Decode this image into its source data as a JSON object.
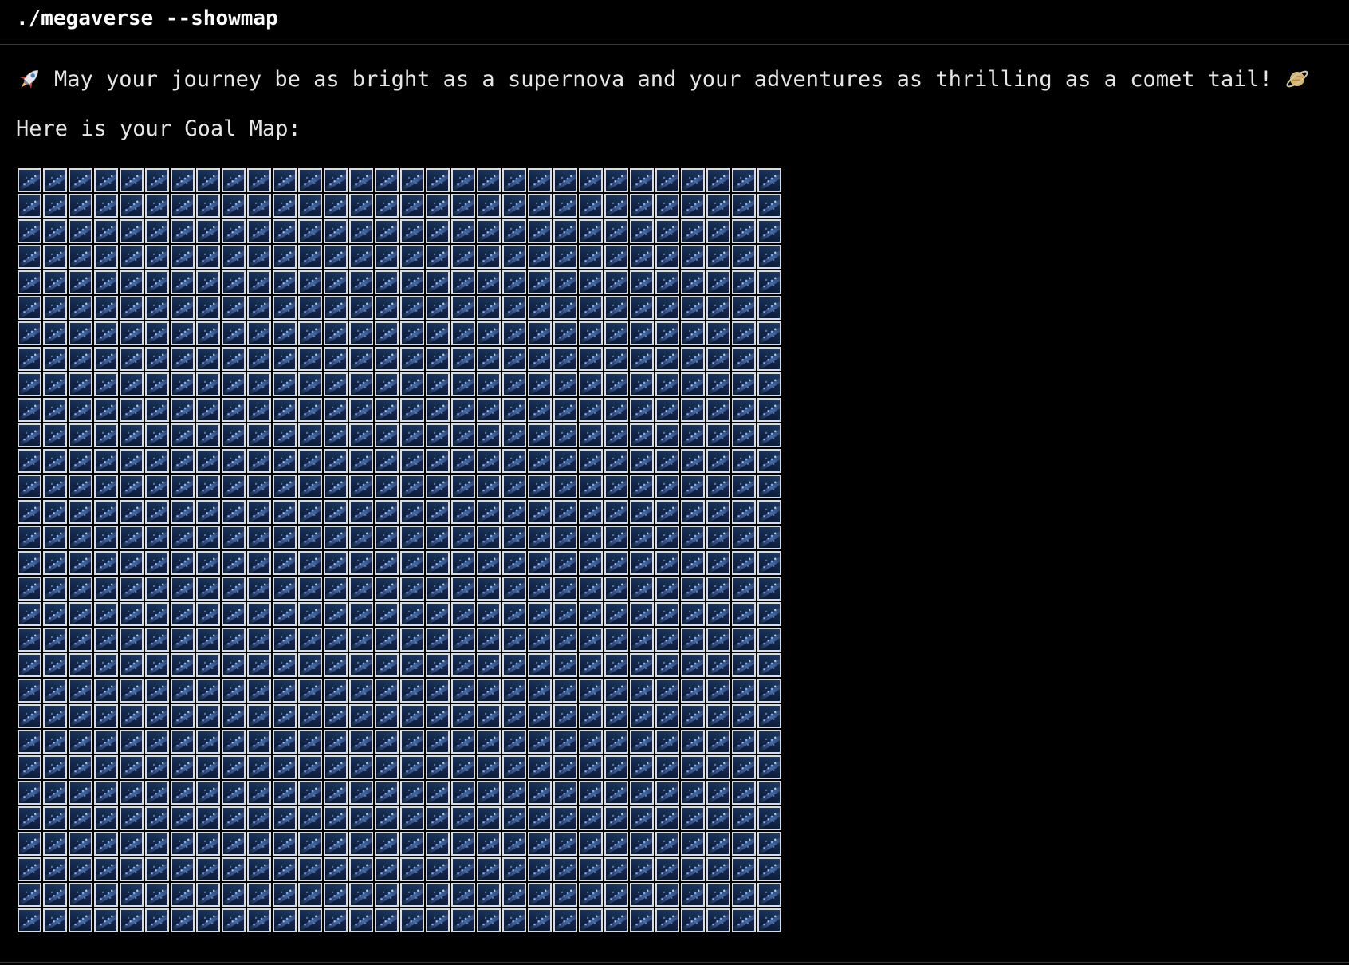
{
  "terminal": {
    "command": "./megaverse --showmap",
    "greeting": {
      "leading_icon": "rocket-icon",
      "text": "May your journey be as bright as a supernova and your adventures as thrilling as a comet tail!",
      "trailing_icon": "ringed-planet-icon"
    },
    "map_label": "Here is your Goal Map:"
  },
  "goal_map": {
    "rows": 30,
    "columns": 30,
    "cell_type": "space",
    "cell_icon": "milky-way-icon"
  },
  "colors": {
    "background": "#000000",
    "text": "#e6e6e6",
    "tile_border": "#d9dbe2",
    "tile_space": "#14284a"
  }
}
